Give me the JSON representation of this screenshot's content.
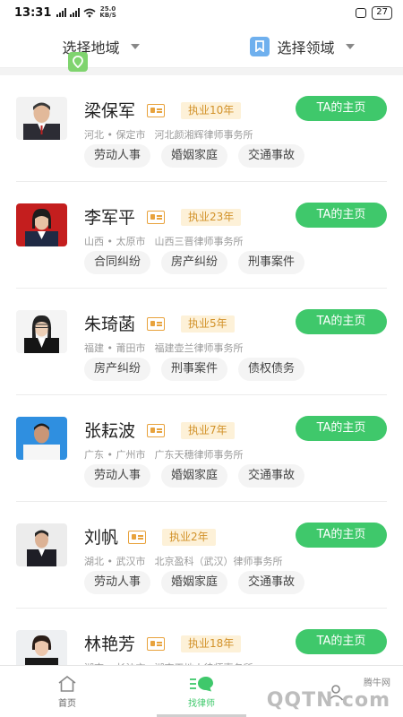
{
  "status_bar": {
    "time": "13:31",
    "network_speed": "25.0",
    "network_unit": "KB/S",
    "battery": "27"
  },
  "filters": {
    "region_label": "选择地域",
    "field_label": "选择领域"
  },
  "lawyers": [
    {
      "name": "梁保军",
      "years": "执业10年",
      "province": "河北",
      "city": "保定市",
      "firm": "河北颜湘辉律师事务所",
      "tags": [
        "劳动人事",
        "婚姻家庭",
        "交通事故"
      ],
      "button": "TA的主页"
    },
    {
      "name": "李军平",
      "years": "执业23年",
      "province": "山西",
      "city": "太原市",
      "firm": "山西三晋律师事务所",
      "tags": [
        "合同纠纷",
        "房产纠纷",
        "刑事案件"
      ],
      "button": "TA的主页"
    },
    {
      "name": "朱琦菡",
      "years": "执业5年",
      "province": "福建",
      "city": "莆田市",
      "firm": "福建壶兰律师事务所",
      "tags": [
        "房产纠纷",
        "刑事案件",
        "债权债务"
      ],
      "button": "TA的主页"
    },
    {
      "name": "张耘波",
      "years": "执业7年",
      "province": "广东",
      "city": "广州市",
      "firm": "广东天穗律师事务所",
      "tags": [
        "劳动人事",
        "婚姻家庭",
        "交通事故"
      ],
      "button": "TA的主页"
    },
    {
      "name": "刘帆",
      "years": "执业2年",
      "province": "湖北",
      "city": "武汉市",
      "firm": "北京盈科（武汉）律师事务所",
      "tags": [
        "劳动人事",
        "婚姻家庭",
        "交通事故"
      ],
      "button": "TA的主页"
    },
    {
      "name": "林艳芳",
      "years": "执业18年",
      "province": "湖南",
      "city": "长沙市",
      "firm": "湖南天地人律师事务所",
      "tags": [],
      "button": "TA的主页"
    }
  ],
  "nav": {
    "home": "首页",
    "find_lawyer": "找律师"
  },
  "watermark": {
    "brand": "QQTN.com",
    "sub": "腾牛网"
  },
  "colors": {
    "accent": "#3fc86b",
    "badge_text": "#d2922a",
    "badge_bg": "#fdf1d8"
  }
}
